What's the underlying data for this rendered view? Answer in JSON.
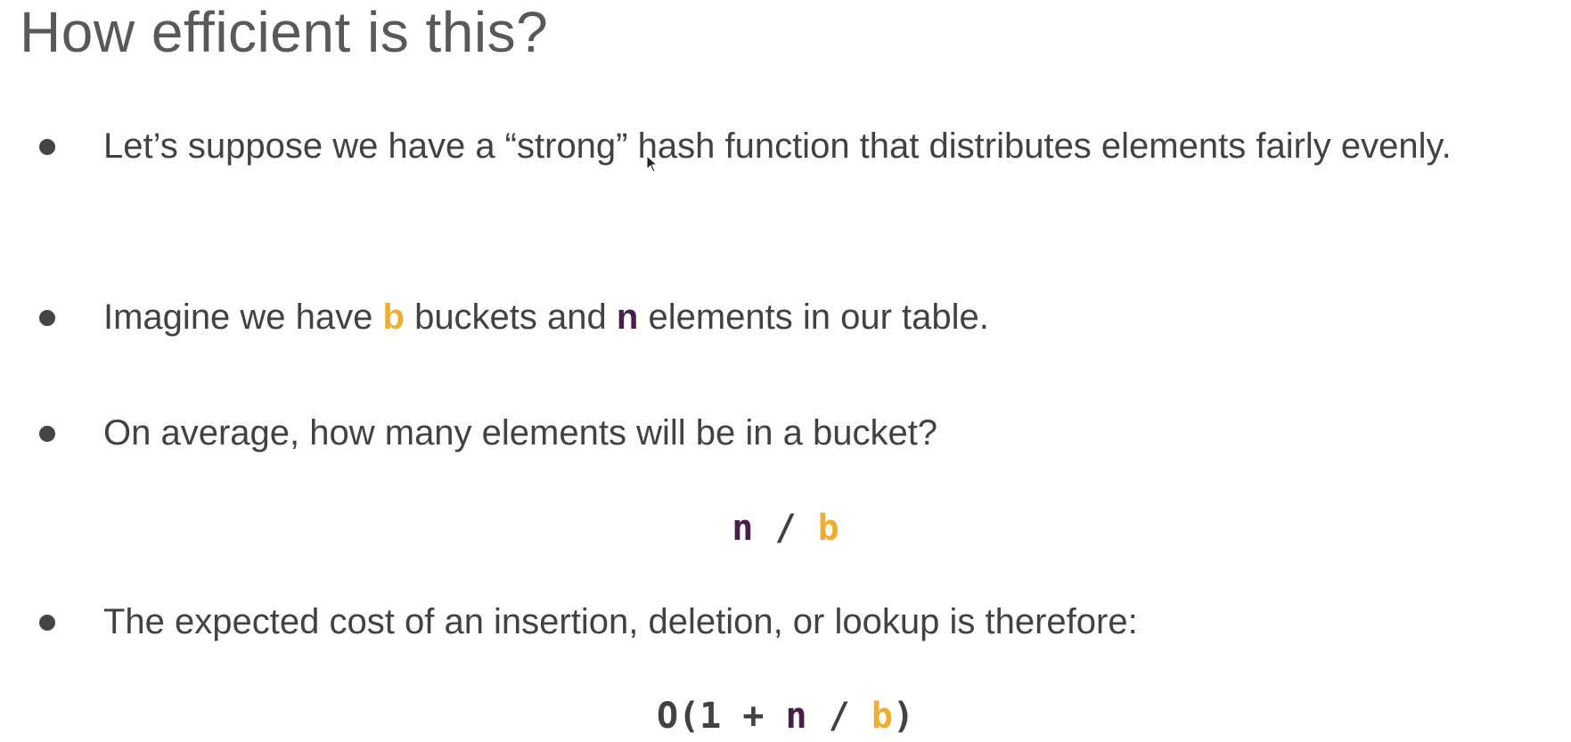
{
  "title": "How efficient is this?",
  "bullets": [
    {
      "text": "Let’s suppose we have a “strong” hash function that distributes elements fairly evenly."
    },
    {
      "prefix": "Imagine we have ",
      "b": "b",
      "middle": " buckets and ",
      "n": "n",
      "suffix": " elements in our table."
    },
    {
      "text": "On average, how many elements will be in a bucket?"
    },
    {
      "text": "The expected cost of an insertion, deletion, or lookup is therefore:"
    }
  ],
  "formula_avg": {
    "n": "n",
    "slash": " / ",
    "b": "b"
  },
  "formula_cost": {
    "open": "O(1 + ",
    "n": "n",
    "slash": " / ",
    "b": "b",
    "close": ")"
  },
  "colors": {
    "b_highlight": "#f0ae30",
    "n_highlight": "#4a1e4a",
    "text": "#424242",
    "title": "#595959"
  },
  "icons": {
    "cursor": "mouse-pointer-icon"
  }
}
